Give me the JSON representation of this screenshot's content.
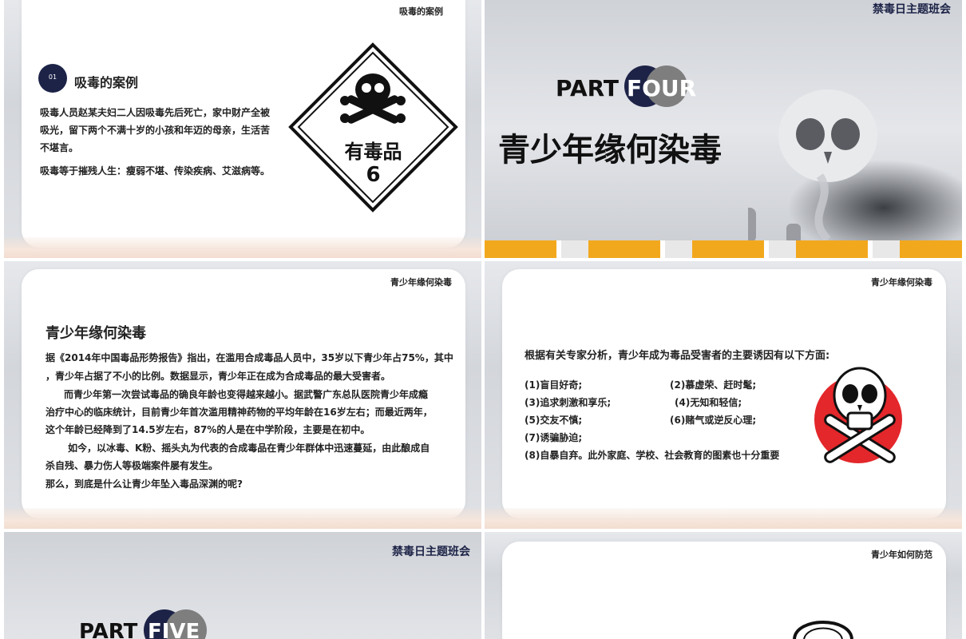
{
  "slide1": {
    "header": "吸毒的案例",
    "badge_number": "01",
    "section_title": "吸毒的案例",
    "para1_line1": "吸毒人员赵某夫妇二人因吸毒先后死亡，家中财产全被",
    "para1_line2": "吸光，留下两个不满十岁的小孩和年迈的母亲，生活苦",
    "para1_line3": "不堪言。",
    "para2": "吸毒等于摧残人生：瘦弱不堪、传染疾病、艾滋病等。",
    "sign_text": "有毒品",
    "sign_number": "6"
  },
  "slide2": {
    "brand": "禁毒日主题班会",
    "part_word": "PART",
    "part_num": "FOUR",
    "title": "青少年缘何染毒"
  },
  "slide3": {
    "header": "青少年缘何染毒",
    "title": "青少年缘何染毒",
    "lines": [
      "据《2014年中国毒品形势报告》指出，在滥用合成毒品人员中，35岁以下青少年占75%，其中",
      "，青少年占据了不小的比例。数据显示，青少年正在成为合成毒品的最大受害者。",
      "而青少年第一次尝试毒品的确良年龄也变得越来越小。据武警广东总队医院青少年成瘾",
      "治疗中心的临床统计，目前青少年首次滥用精神药物的平均年龄在16岁左右；而最近两年，",
      "这个年龄已经降到了14.5岁左右，87%的人是在中学阶段，主要是在初中。",
      "如今，以冰毒、K粉、摇头丸为代表的合成毒品在青少年群体中迅速蔓延，由此酿成自",
      "杀自残、暴力伤人等极端案件屡有发生。",
      "那么，到底是什么让青少年坠入毒品深渊的呢?"
    ]
  },
  "slide4": {
    "header": "青少年缘何染毒",
    "lead": "根据有关专家分析，青少年成为毒品受害者的主要诱因有以下方面:",
    "items": [
      "(1)盲目好奇;",
      "(2)慕虚荣、赶时髦;",
      "(3)追求刺激和享乐;",
      "(4)无知和轻信;",
      "(5)交友不慎;",
      "(6)赌气或逆反心理;",
      "(7)诱骗胁迫;",
      "(8)自暴自弃。此外家庭、学校、社会教育的图素也十分重要"
    ]
  },
  "slide5": {
    "brand": "禁毒日主题班会",
    "part_word": "PART",
    "part_num": "FIVE"
  },
  "slide6": {
    "header": "青少年如何防范"
  },
  "colors": {
    "navy": "#1d2347",
    "grey_circle": "#7e7e7e",
    "red_disc": "#e3272b",
    "orange_strip": "#f2a81d"
  }
}
